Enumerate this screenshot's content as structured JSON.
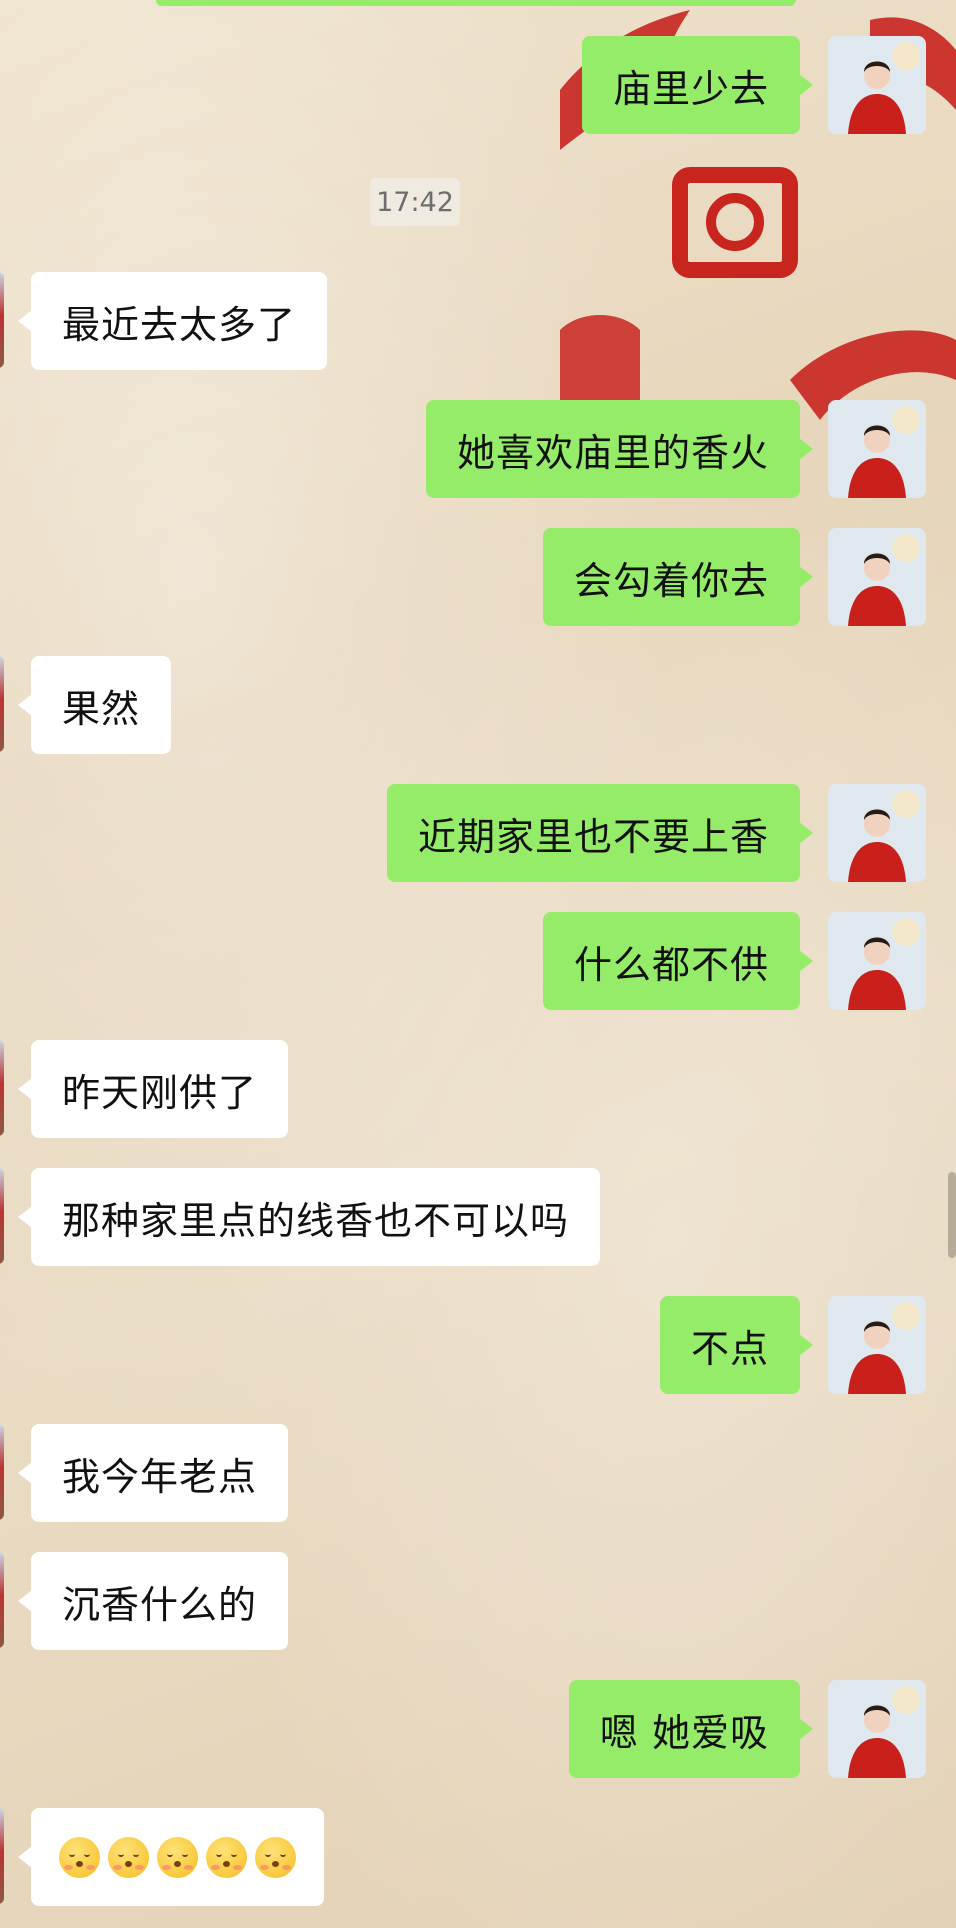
{
  "timestamp": "17:42",
  "colors": {
    "my_bubble": "#95ec69",
    "their_bubble": "#ffffff",
    "text": "#111111",
    "timestamp_text": "#6d6d6d"
  },
  "messages": [
    {
      "sender": "me",
      "text": "庙里少去"
    },
    {
      "sender": "them",
      "text": "最近去太多了"
    },
    {
      "sender": "me",
      "text": "她喜欢庙里的香火"
    },
    {
      "sender": "me",
      "text": "会勾着你去"
    },
    {
      "sender": "them",
      "text": "果然"
    },
    {
      "sender": "me",
      "text": "近期家里也不要上香"
    },
    {
      "sender": "me",
      "text": "什么都不供"
    },
    {
      "sender": "them",
      "text": "昨天刚供了"
    },
    {
      "sender": "them",
      "text": "那种家里点的线香也不可以吗"
    },
    {
      "sender": "me",
      "text": "不点"
    },
    {
      "sender": "them",
      "text": "我今年老点"
    },
    {
      "sender": "them",
      "text": "沉香什么的"
    },
    {
      "sender": "me",
      "text": "嗯 她爱吸"
    },
    {
      "sender": "them",
      "emoji": [
        "blushing-smile-emoji",
        "blushing-smile-emoji",
        "blushing-smile-emoji",
        "blushing-smile-emoji",
        "blushing-smile-emoji"
      ]
    }
  ]
}
